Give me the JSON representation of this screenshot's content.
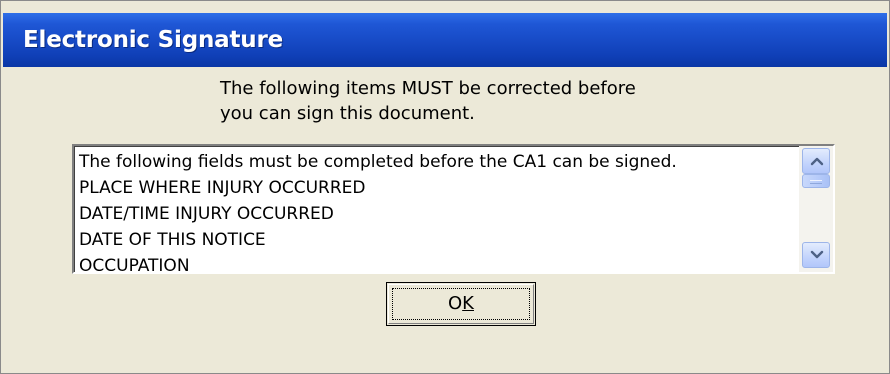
{
  "window": {
    "title": "Electronic Signature"
  },
  "message": {
    "line1": "The following items MUST be corrected before",
    "line2": "you can sign this document."
  },
  "list": {
    "items": [
      "The following fields must be completed before the  CA1 can be signed.",
      "PLACE WHERE INJURY OCCURRED",
      "DATE/TIME INJURY OCCURRED",
      "DATE OF THIS NOTICE",
      "OCCUPATION"
    ],
    "scroll_position": 0.1
  },
  "buttons": {
    "ok_main": "O",
    "ok_mnemonic": "K"
  },
  "icons": {
    "scroll_up": "up-arrow",
    "scroll_down": "down-arrow"
  },
  "colors": {
    "titlebar": "#0f3fb6",
    "dialog_background": "#ece9d8",
    "scroll_arrow": "#4d6185"
  }
}
